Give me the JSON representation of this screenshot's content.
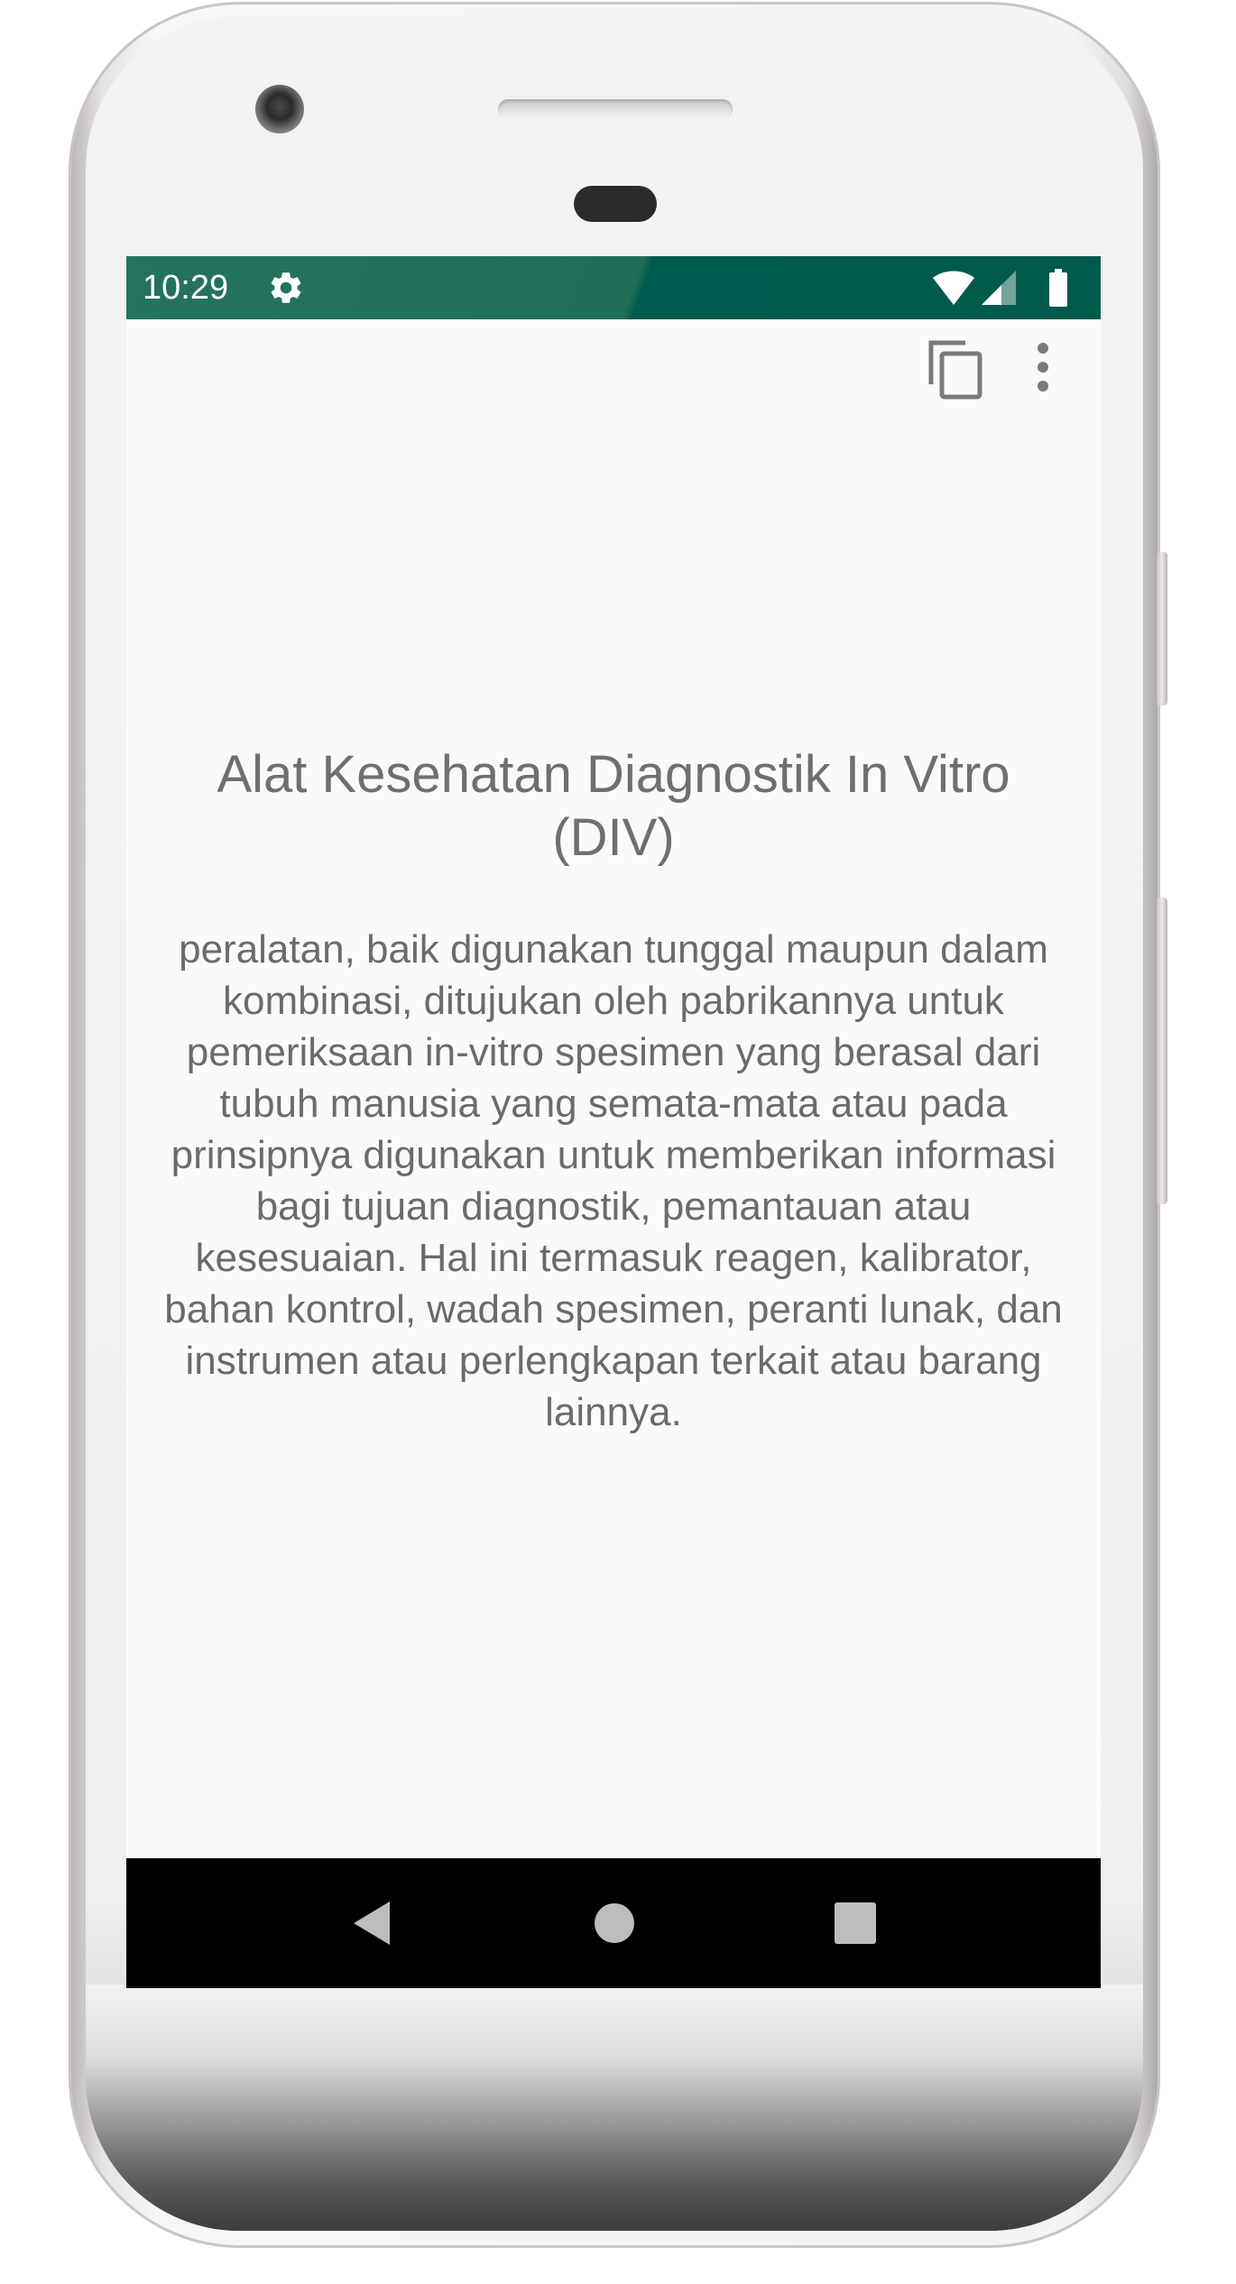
{
  "status_bar": {
    "time": "10:29",
    "settings_icon": "gear-icon",
    "wifi_icon": "wifi-icon",
    "signal_icon": "signal-icon",
    "battery_icon": "battery-icon",
    "colors": {
      "left": "#24735d",
      "right": "#005a4c"
    }
  },
  "toolbar": {
    "copy_icon": "copy-icon",
    "more_icon": "more-vert-icon"
  },
  "content": {
    "title": "Alat Kesehatan Diagnostik In Vitro (DIV)",
    "body": "peralatan, baik digunakan tunggal maupun dalam kombinasi, ditujukan oleh pabrikannya untuk pemeriksaan in-vitro spesimen yang berasal dari tubuh manusia yang semata-mata atau pada prinsipnya digunakan untuk memberikan informasi bagi tujuan diagnostik, pemantauan atau kesesuaian. Hal ini termasuk reagen, kalibrator, bahan kontrol, wadah spesimen, peranti lunak, dan instrumen atau perlengkapan terkait atau barang lainnya."
  },
  "nav_bar": {
    "back_icon": "back-triangle-icon",
    "home_icon": "home-circle-icon",
    "recents_icon": "recents-square-icon"
  }
}
